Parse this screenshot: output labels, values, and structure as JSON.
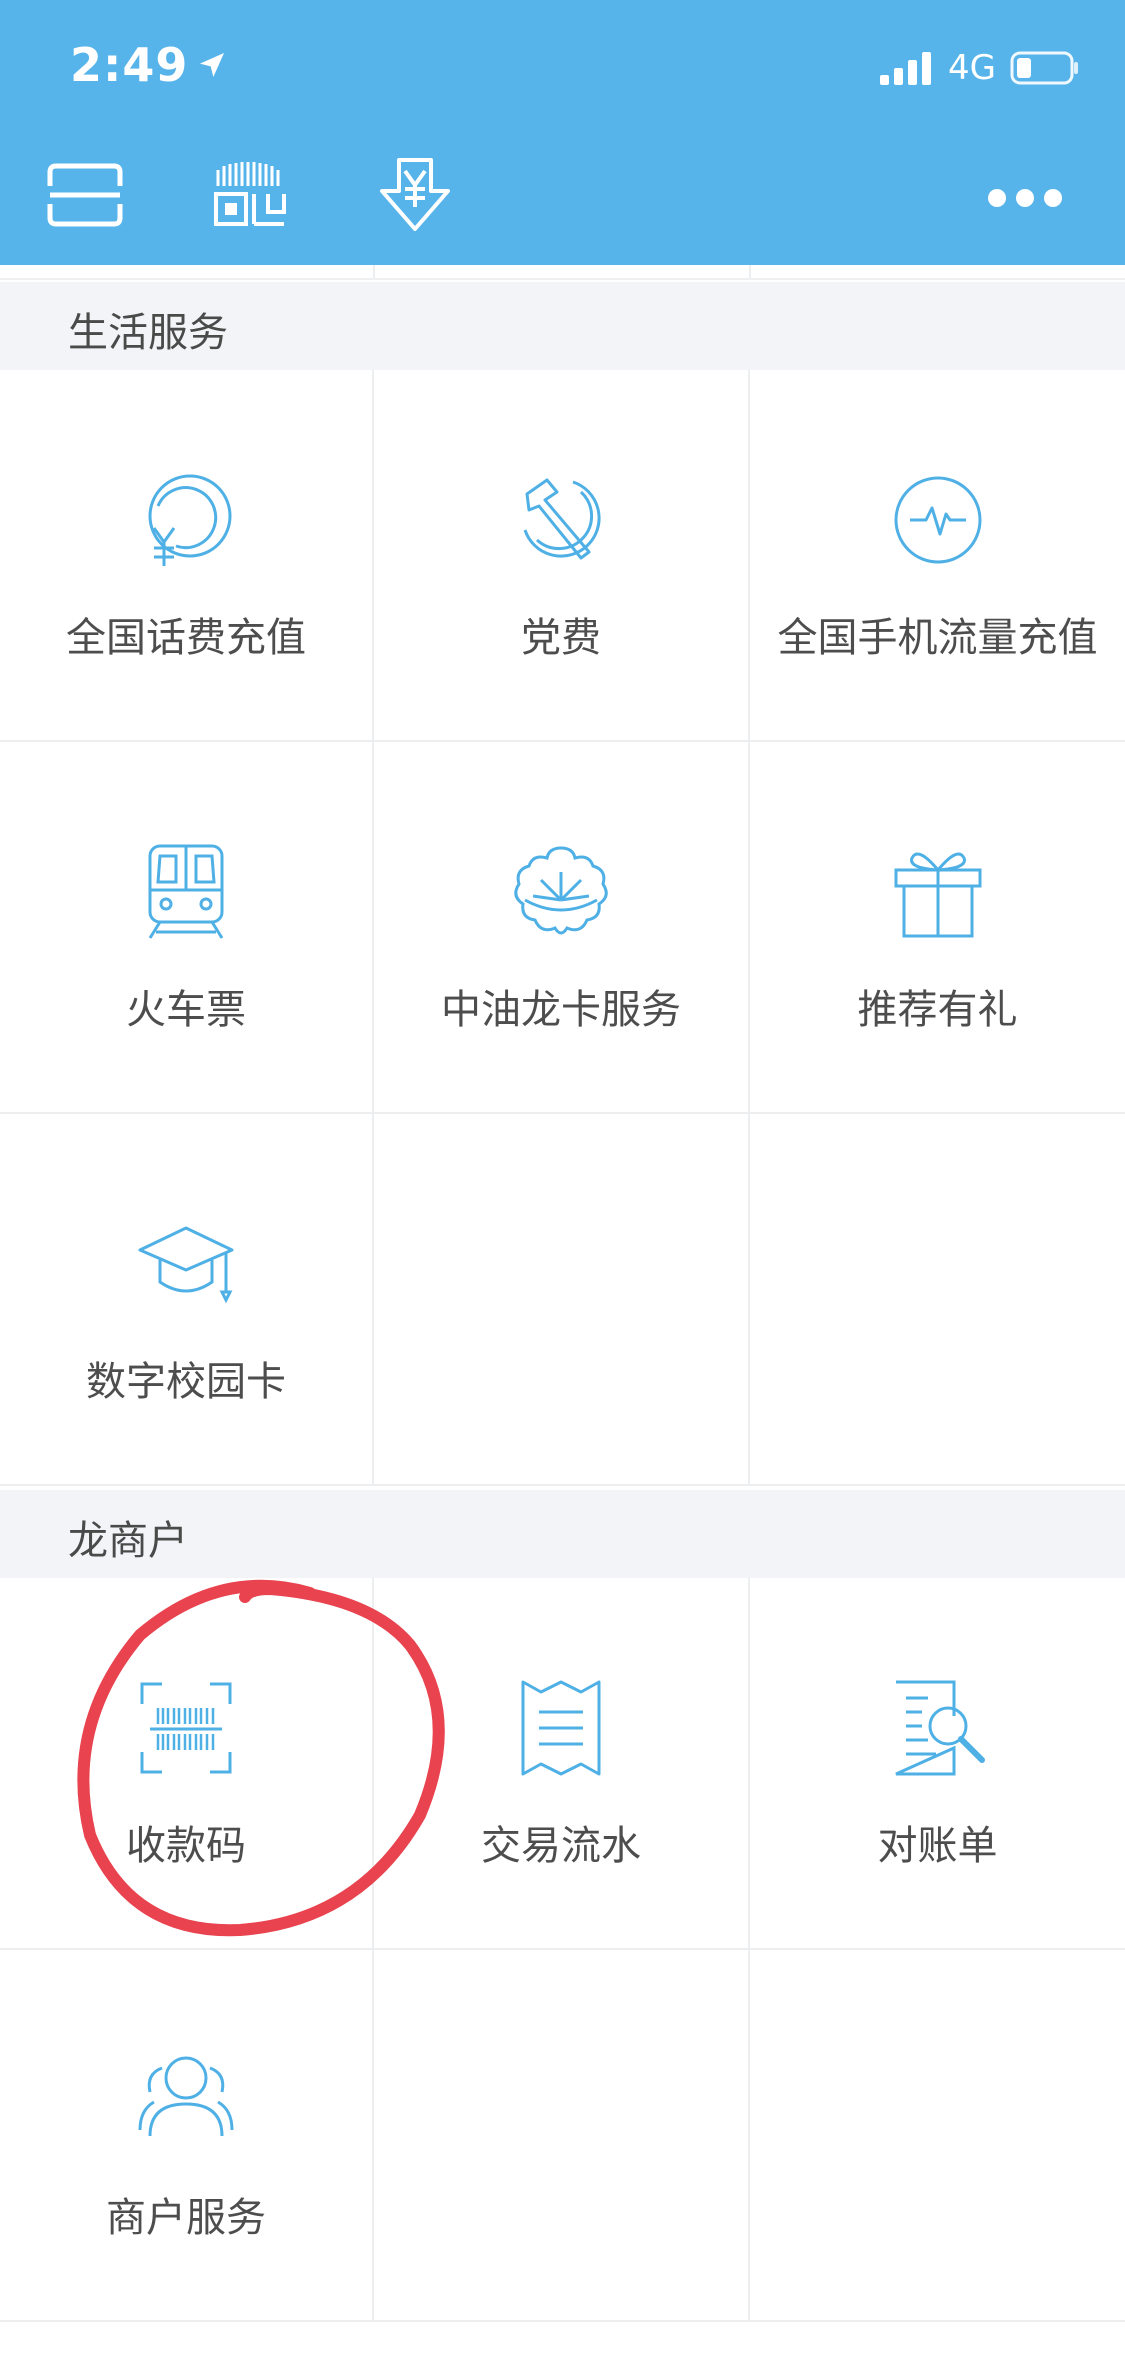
{
  "status_bar": {
    "time": "2:49",
    "network": "4G"
  },
  "toolbar": {
    "buttons": [
      "scan-icon",
      "barcode-icon",
      "yuan-download-icon"
    ],
    "more": "more-icon"
  },
  "sections": [
    {
      "title": "生活服务",
      "items": [
        {
          "label": "全国话费充值",
          "icon": "phone-recharge-icon"
        },
        {
          "label": "党费",
          "icon": "party-emblem-icon"
        },
        {
          "label": "全国手机流量充值",
          "icon": "data-pulse-icon"
        },
        {
          "label": "火车票",
          "icon": "train-icon"
        },
        {
          "label": "中油龙卡服务",
          "icon": "petrochina-icon"
        },
        {
          "label": "推荐有礼",
          "icon": "gift-icon"
        },
        {
          "label": "数字校园卡",
          "icon": "graduation-cap-icon"
        }
      ]
    },
    {
      "title": "龙商户",
      "items": [
        {
          "label": "收款码",
          "icon": "payment-code-icon"
        },
        {
          "label": "交易流水",
          "icon": "receipt-icon"
        },
        {
          "label": "对账单",
          "icon": "statement-search-icon"
        },
        {
          "label": "商户服务",
          "icon": "merchant-users-icon"
        }
      ]
    }
  ],
  "colors": {
    "header": "#56b4eb",
    "icon": "#4fb0e6",
    "annotation": "#e8434e"
  }
}
